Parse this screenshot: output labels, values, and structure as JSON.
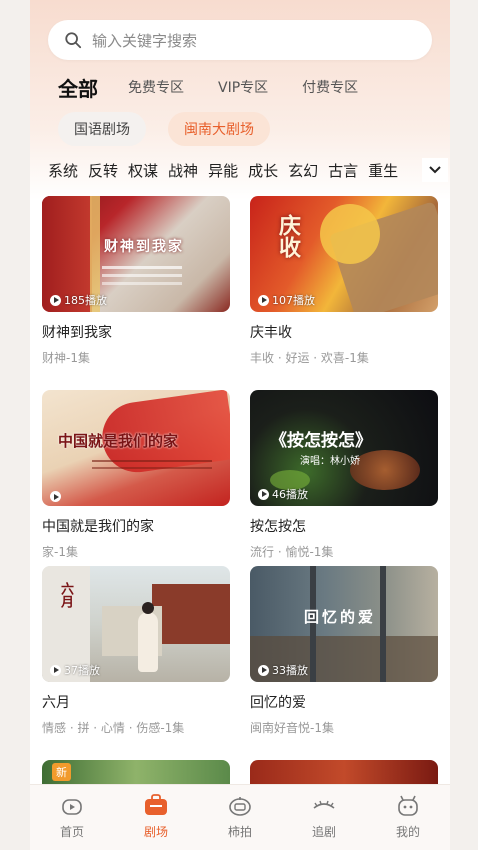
{
  "search": {
    "placeholder": "输入关键字搜索"
  },
  "tabs": [
    {
      "label": "全部",
      "active": true
    },
    {
      "label": "免费专区"
    },
    {
      "label": "VIP专区"
    },
    {
      "label": "付费专区"
    }
  ],
  "venues": [
    {
      "label": "国语剧场"
    },
    {
      "label": "闽南大剧场",
      "active": true
    }
  ],
  "genres": [
    "系统",
    "反转",
    "权谋",
    "战神",
    "异能",
    "成长",
    "玄幻",
    "古言",
    "重生"
  ],
  "cards": [
    {
      "title": "财神到我家",
      "tags": "财神-1集",
      "plays": "185播放",
      "overlay": "财神到我家"
    },
    {
      "title": "庆丰收",
      "tags": "丰收 · 好运 · 欢喜-1集",
      "plays": "107播放",
      "overlay": "庆收"
    },
    {
      "title": "中国就是我们的家",
      "tags": "家-1集",
      "plays": "",
      "overlay": "中国就是我们的家"
    },
    {
      "title": "按怎按怎",
      "tags": "流行 · 愉悦-1集",
      "plays": "46播放",
      "overlay": "《按怎按怎》",
      "overlay2": "演唱：林小娇"
    },
    {
      "title": "六月",
      "tags": "情感 · 拼 · 心情 · 伤感-1集",
      "plays": "37播放",
      "overlay": "六月"
    },
    {
      "title": "回忆的爱",
      "tags": "闽南好音悦-1集",
      "plays": "33播放",
      "overlay": "回忆的爱"
    }
  ],
  "badge_new": "新",
  "nav": [
    {
      "label": "首页",
      "icon": "home-icon"
    },
    {
      "label": "剧场",
      "icon": "theater-icon",
      "active": true
    },
    {
      "label": "柿拍",
      "icon": "camera-icon"
    },
    {
      "label": "追剧",
      "icon": "eye-icon"
    },
    {
      "label": "我的",
      "icon": "profile-icon"
    }
  ],
  "colors": {
    "accent": "#e8602c"
  }
}
